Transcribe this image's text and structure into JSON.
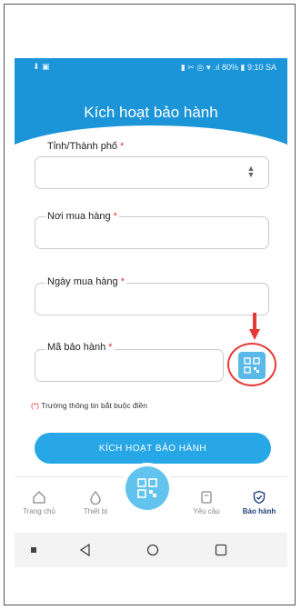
{
  "status_bar": {
    "left_icons": "⬇ ▣",
    "right_text": "▮ ✂ ◎ ♥ .ıl 80% ▮ 9:10 SA"
  },
  "header": {
    "title": "Kích hoạt bảo hành"
  },
  "form": {
    "province": {
      "label": "Tỉnh/Thành phố",
      "required_mark": "*"
    },
    "purchase_place": {
      "label": "Nơi mua hàng",
      "required_mark": "*"
    },
    "purchase_date": {
      "label": "Ngày mua hàng",
      "required_mark": "*"
    },
    "warranty_code": {
      "label": "Mã bảo hành",
      "required_mark": "*"
    },
    "required_note_mark": "(*)",
    "required_note": "Trường thông tin bắt buộc điền",
    "submit_label": "KÍCH HOẠT BẢO HÀNH"
  },
  "bottom_nav": {
    "items": [
      {
        "label": "Trang chủ",
        "icon": "home-icon"
      },
      {
        "label": "Thiết bị",
        "icon": "drop-icon"
      },
      {
        "label": "Yêu cầu",
        "icon": "document-icon"
      },
      {
        "label": "Bảo hành",
        "icon": "shield-check-icon",
        "active": true
      }
    ],
    "center_icon": "qr-scan-icon"
  },
  "colors": {
    "header": "#1b95d8",
    "button": "#27a7e6",
    "active_nav": "#23407a",
    "annotation": "#e53935"
  }
}
